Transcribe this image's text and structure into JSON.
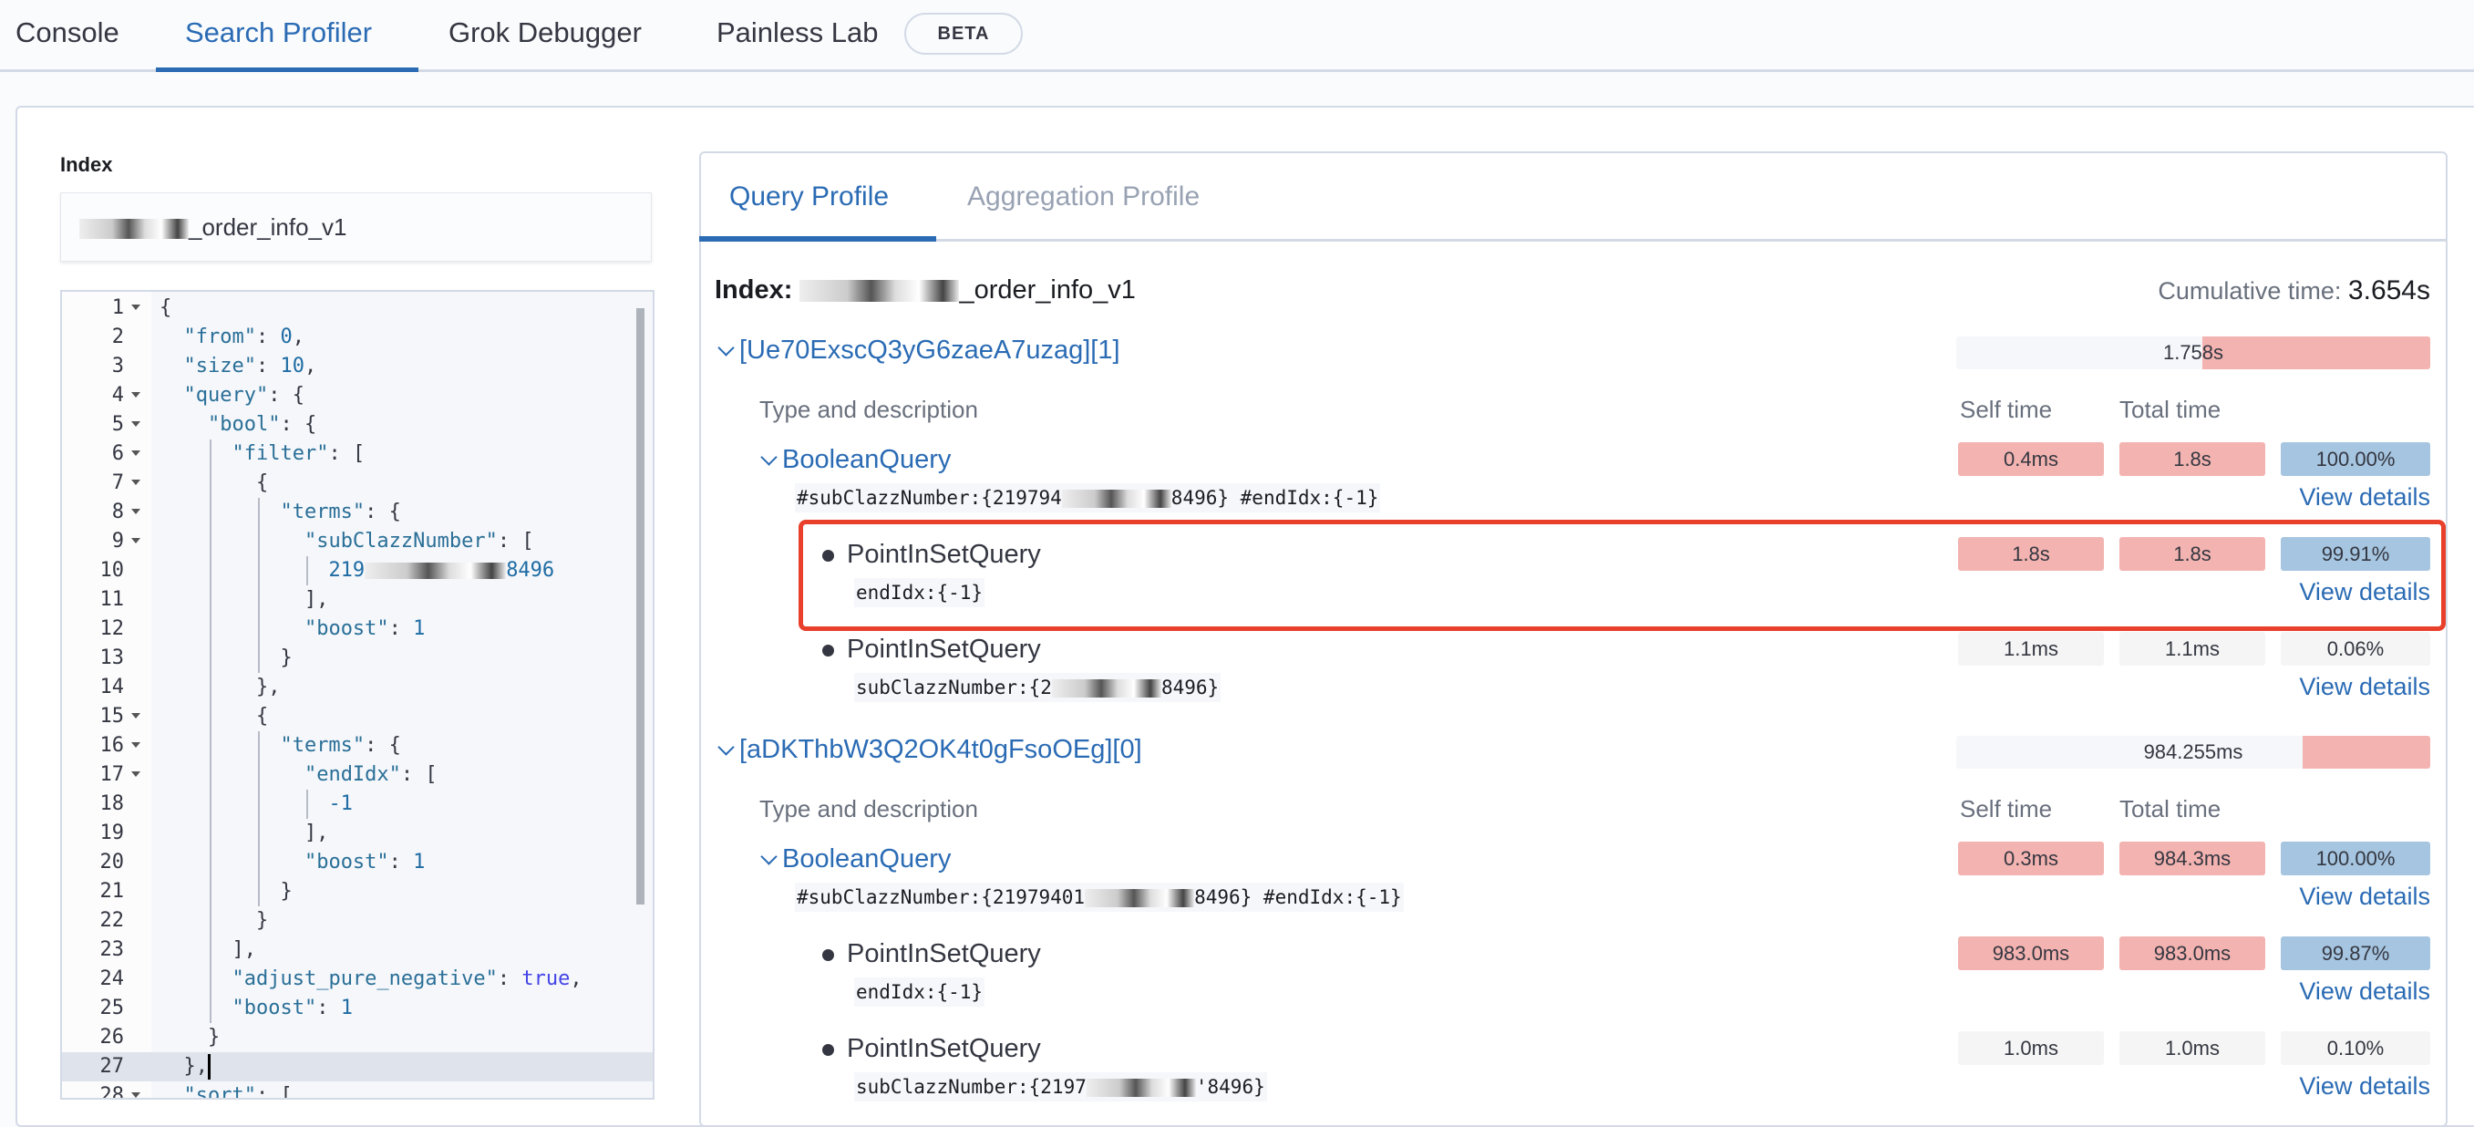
{
  "top_tabs": [
    {
      "label": "Console",
      "active": false
    },
    {
      "label": "Search Profiler",
      "active": true
    },
    {
      "label": "Grok Debugger",
      "active": false
    },
    {
      "label": "Painless Lab",
      "active": false,
      "badge": "BETA"
    }
  ],
  "left": {
    "index_label": "Index",
    "index_value_visible": "_order_info_v1",
    "editor": {
      "active_line": 27,
      "lines": [
        {
          "n": "1",
          "text": "{",
          "fold": true
        },
        {
          "n": "2",
          "text": "  \"from\": 0,"
        },
        {
          "n": "3",
          "text": "  \"size\": 10,"
        },
        {
          "n": "4",
          "text": "  \"query\": {",
          "fold": true
        },
        {
          "n": "5",
          "text": "    \"bool\": {",
          "fold": true
        },
        {
          "n": "6",
          "text": "      \"filter\": [",
          "fold": true
        },
        {
          "n": "7",
          "text": "        {",
          "fold": true
        },
        {
          "n": "8",
          "text": "          \"terms\": {",
          "fold": true
        },
        {
          "n": "9",
          "text": "            \"subClazzNumber\": [",
          "fold": true
        },
        {
          "n": "10",
          "text": "              219",
          "redacted_tail": "8496"
        },
        {
          "n": "11",
          "text": "            ],"
        },
        {
          "n": "12",
          "text": "            \"boost\": 1"
        },
        {
          "n": "13",
          "text": "          }"
        },
        {
          "n": "14",
          "text": "        },"
        },
        {
          "n": "15",
          "text": "        {",
          "fold": true
        },
        {
          "n": "16",
          "text": "          \"terms\": {",
          "fold": true
        },
        {
          "n": "17",
          "text": "            \"endIdx\": [",
          "fold": true
        },
        {
          "n": "18",
          "text": "              -1"
        },
        {
          "n": "19",
          "text": "            ],"
        },
        {
          "n": "20",
          "text": "            \"boost\": 1"
        },
        {
          "n": "21",
          "text": "          }"
        },
        {
          "n": "22",
          "text": "        }"
        },
        {
          "n": "23",
          "text": "      ],"
        },
        {
          "n": "24",
          "text": "      \"adjust_pure_negative\": true,"
        },
        {
          "n": "25",
          "text": "      \"boost\": 1"
        },
        {
          "n": "26",
          "text": "    }"
        },
        {
          "n": "27",
          "text": "  },"
        },
        {
          "n": "28",
          "text": "  \"sort\": [",
          "fold": true
        }
      ]
    }
  },
  "profile": {
    "tabs": [
      {
        "label": "Query Profile",
        "active": true
      },
      {
        "label": "Aggregation Profile",
        "active": false
      }
    ],
    "index_label": "Index:",
    "index_value_visible": "_order_info_v1",
    "cumulative_label": "Cumulative time:",
    "cumulative_value": "3.654s",
    "col_type": "Type and description",
    "col_self": "Self time",
    "col_total": "Total time",
    "view_details": "View details",
    "shards": [
      {
        "name": "[Ue70ExscQ3yG6zaeA7uzag][1]",
        "time": "1.758s",
        "bar_fraction": 0.481,
        "queries": [
          {
            "type": "BooleanQuery",
            "desc_prefix": "#subClazzNumber:{219794",
            "desc_suffix": "8496} #endIdx:{-1}",
            "self": "0.4ms",
            "total": "1.8s",
            "pct": "100.00%",
            "self_color": "pink",
            "total_color": "pink",
            "pct_color": "blue"
          },
          {
            "type": "PointInSetQuery",
            "desc_prefix": "endIdx:{-1}",
            "desc_suffix": "",
            "self": "1.8s",
            "total": "1.8s",
            "pct": "99.91%",
            "self_color": "pink",
            "total_color": "pink",
            "pct_color": "blue",
            "highlighted": true
          },
          {
            "type": "PointInSetQuery",
            "desc_prefix": "subClazzNumber:{2",
            "desc_suffix": "8496}",
            "self": "1.1ms",
            "total": "1.1ms",
            "pct": "0.06%",
            "self_color": "gray",
            "total_color": "gray",
            "pct_color": "gray"
          }
        ]
      },
      {
        "name": "[aDKThbW3Q2OK4t0gFsoOEg][0]",
        "time": "984.255ms",
        "bar_fraction": 0.269,
        "queries": [
          {
            "type": "BooleanQuery",
            "desc_prefix": "#subClazzNumber:{21979401",
            "desc_suffix": "8496} #endIdx:{-1}",
            "self": "0.3ms",
            "total": "984.3ms",
            "pct": "100.00%",
            "self_color": "pink",
            "total_color": "pink",
            "pct_color": "blue"
          },
          {
            "type": "PointInSetQuery",
            "desc_prefix": "endIdx:{-1}",
            "desc_suffix": "",
            "self": "983.0ms",
            "total": "983.0ms",
            "pct": "99.87%",
            "self_color": "pink",
            "total_color": "pink",
            "pct_color": "blue"
          },
          {
            "type": "PointInSetQuery",
            "desc_prefix": "subClazzNumber:{2197",
            "desc_suffix": "'8496}",
            "self": "1.0ms",
            "total": "1.0ms",
            "pct": "0.10%",
            "self_color": "gray",
            "total_color": "gray",
            "pct_color": "gray"
          }
        ]
      }
    ]
  },
  "colors": {
    "accent": "#2a6bb4",
    "slow": "#f3b3b0",
    "percent": "#a6c5e0",
    "highlight_box": "#e8402b"
  }
}
